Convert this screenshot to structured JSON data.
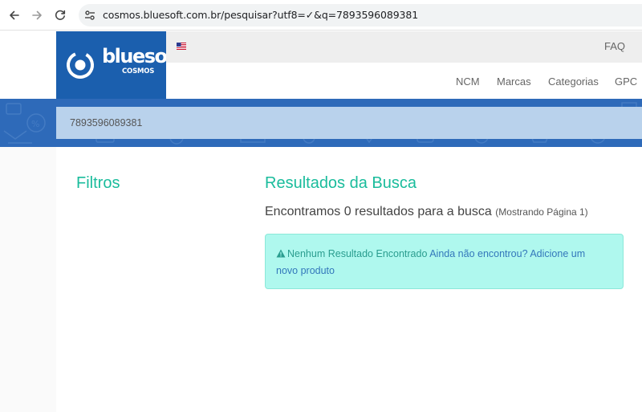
{
  "browser": {
    "url": "cosmos.bluesoft.com.br/pesquisar?utf8=✓&q=7893596089381",
    "back_icon": "arrow-left-icon",
    "forward_icon": "arrow-right-icon",
    "reload_icon": "reload-icon",
    "site_info_icon": "tune-icon"
  },
  "header": {
    "logo_word": "bluesoft",
    "logo_sub": "COSMOS",
    "flag_icon": "us-flag-icon",
    "faq": "FAQ",
    "menu": [
      "NCM",
      "Marcas",
      "Categorias",
      "GPC"
    ]
  },
  "search": {
    "value": "7893596089381"
  },
  "sidebar": {
    "title": "Filtros"
  },
  "results": {
    "title": "Resultados da Busca",
    "count_text": "Encontramos 0 resultados para a busca",
    "page_text": "(Mostrando Página 1)",
    "alert": {
      "icon": "warning-icon",
      "message": "Nenhum Resultado Encontrado",
      "link_text": "Ainda não encontrou? Adicione um novo produto"
    }
  },
  "colors": {
    "brand_blue": "#1b5fae",
    "banner_blue": "#2e6ab9",
    "accent_green": "#1abc9c",
    "alert_bg": "#aff8ee"
  }
}
